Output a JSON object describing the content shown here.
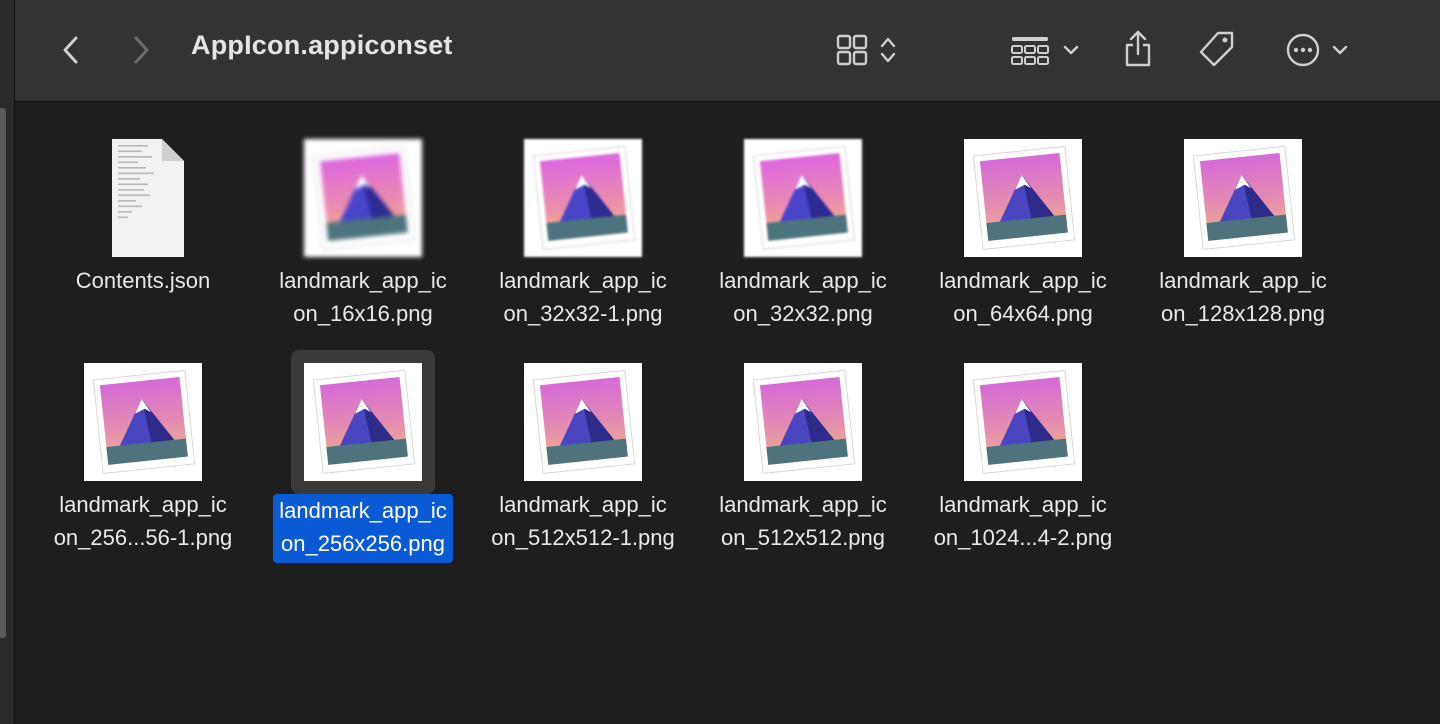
{
  "window": {
    "title": "AppIcon.appiconset"
  },
  "toolbar": {
    "back_icon": "chevron-left-icon",
    "forward_icon": "chevron-right-icon",
    "view_icon": "grid-view-icon",
    "group_icon": "group-by-icon",
    "share_icon": "share-icon",
    "tag_icon": "tag-icon",
    "more_icon": "ellipsis-circle-icon"
  },
  "colors": {
    "selection": "#0a5ad6",
    "toolbar_bg": "#333333",
    "window_bg": "#1e1e1e"
  },
  "files": [
    {
      "line1": "Contents.json",
      "line2": "",
      "kind": "json"
    },
    {
      "line1": "landmark_app_ic",
      "line2": "on_16x16.png",
      "kind": "pixel16"
    },
    {
      "line1": "landmark_app_ic",
      "line2": "on_32x32-1.png",
      "kind": "pixel32"
    },
    {
      "line1": "landmark_app_ic",
      "line2": "on_32x32.png",
      "kind": "pixel32"
    },
    {
      "line1": "landmark_app_ic",
      "line2": "on_64x64.png",
      "kind": "icon"
    },
    {
      "line1": "landmark_app_ic",
      "line2": "on_128x128.png",
      "kind": "icon"
    },
    {
      "line1": "landmark_app_ic",
      "line2": "on_256...56-1.png",
      "kind": "icon"
    },
    {
      "line1": "landmark_app_ic",
      "line2": "on_256x256.png",
      "kind": "icon",
      "selected": true
    },
    {
      "line1": "landmark_app_ic",
      "line2": "on_512x512-1.png",
      "kind": "icon"
    },
    {
      "line1": "landmark_app_ic",
      "line2": "on_512x512.png",
      "kind": "icon"
    },
    {
      "line1": "landmark_app_ic",
      "line2": "on_1024...4-2.png",
      "kind": "icon"
    }
  ]
}
